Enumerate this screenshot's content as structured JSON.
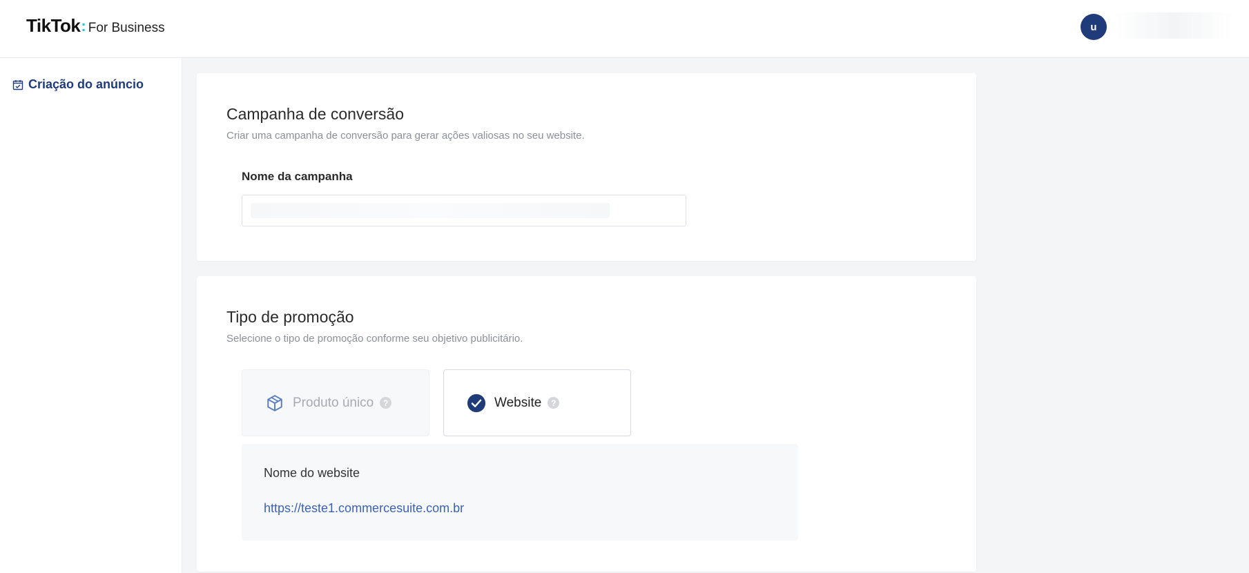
{
  "brand": {
    "logo_text": "TikTok",
    "sub_text": "For Business"
  },
  "user": {
    "avatar_initial": "u"
  },
  "sidebar": {
    "items": [
      {
        "label": "Criação do anúncio",
        "icon": "calendar-check-icon"
      }
    ]
  },
  "campaign": {
    "title": "Campanha de conversão",
    "description": "Criar uma campanha de conversão para gerar ações valiosas no seu website.",
    "name_label": "Nome da campanha",
    "name_value": ""
  },
  "promotion": {
    "title": "Tipo de promoção",
    "description": "Selecione o tipo de promoção conforme seu objetivo publicitário.",
    "options": [
      {
        "label": "Produto único",
        "state": "disabled",
        "icon": "box-icon"
      },
      {
        "label": "Website",
        "state": "selected",
        "icon": "check-circle-icon"
      }
    ],
    "website": {
      "label": "Nome do website",
      "url": "https://teste1.commercesuite.com.br"
    }
  },
  "colors": {
    "accent": "#1f3b7a",
    "link": "#3b62b0",
    "page_bg": "#f4f5f7"
  }
}
